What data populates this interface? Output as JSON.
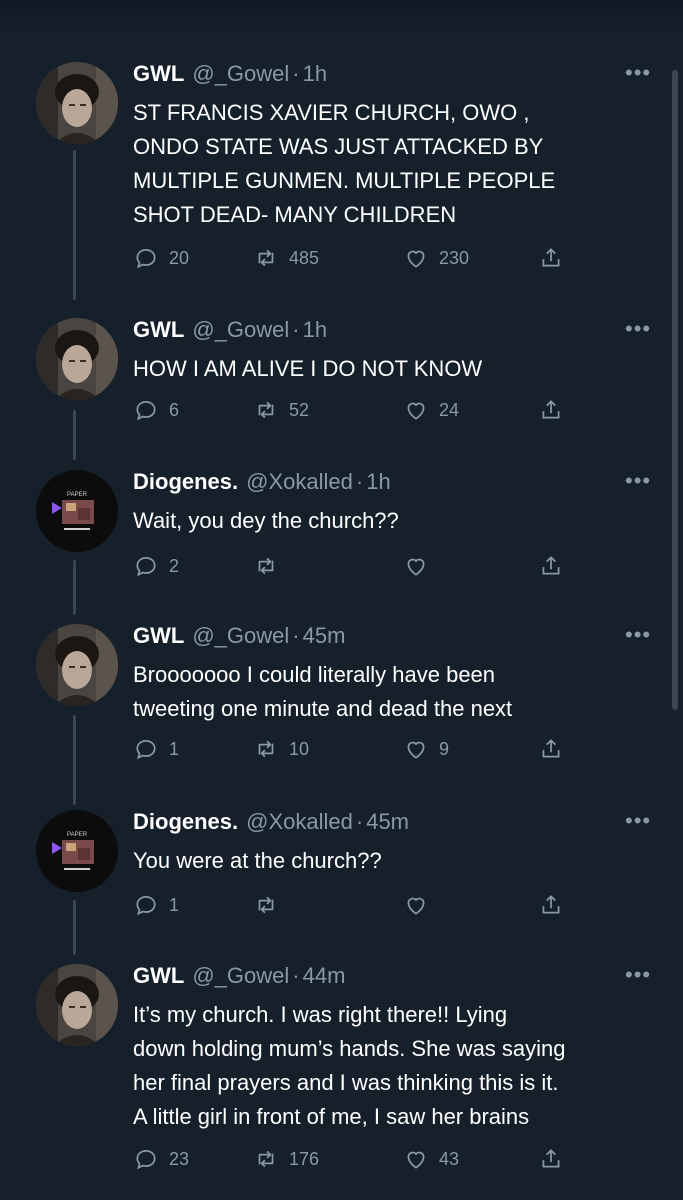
{
  "tweets": [
    {
      "name": "GWL",
      "handle": "@_Gowel",
      "time": "1h",
      "lines": [
        "ST FRANCIS XAVIER CHURCH, OWO ,",
        "ONDO STATE WAS JUST ATTACKED BY",
        "MULTIPLE GUNMEN. MULTIPLE PEOPLE",
        "SHOT DEAD- MANY CHILDREN"
      ],
      "avatar": "man-curly-hair",
      "replies": "20",
      "retweets": "485",
      "likes": "230"
    },
    {
      "name": "GWL",
      "handle": "@_Gowel",
      "time": "1h",
      "lines": [
        "HOW I AM ALIVE I DO NOT KNOW"
      ],
      "avatar": "man-curly-hair",
      "replies": "6",
      "retweets": "52",
      "likes": "24"
    },
    {
      "name": "Diogenes.",
      "handle": "@Xokalled",
      "time": "1h",
      "lines": [
        "Wait, you dey the church??"
      ],
      "avatar": "paper-album-cover",
      "avatar_text": "PAPER",
      "replies": "2",
      "retweets": "",
      "likes": ""
    },
    {
      "name": "GWL",
      "handle": "@_Gowel",
      "time": "45m",
      "lines": [
        "Brooooooo I could literally have been",
        "tweeting one minute and dead the next"
      ],
      "avatar": "man-curly-hair",
      "replies": "1",
      "retweets": "10",
      "likes": "9"
    },
    {
      "name": "Diogenes.",
      "handle": "@Xokalled",
      "time": "45m",
      "lines": [
        "You were at the church??"
      ],
      "avatar": "paper-album-cover",
      "avatar_text": "PAPER",
      "replies": "1",
      "retweets": "",
      "likes": ""
    },
    {
      "name": "GWL",
      "handle": "@_Gowel",
      "time": "44m",
      "lines": [
        "It’s my church. I was right there!! Lying",
        "down holding mum’s hands. She was saying",
        "her final prayers and I was thinking this is it.",
        "A little girl in front of me, I saw her brains"
      ],
      "avatar": "man-curly-hair",
      "replies": "23",
      "retweets": "176",
      "likes": "43"
    }
  ],
  "colors": {
    "background": "#15202b",
    "secondary_text": "#8b98a5",
    "thread_line": "#3a4652"
  },
  "icons": [
    "reply-icon",
    "retweet-icon",
    "like-icon",
    "share-icon",
    "more-icon"
  ]
}
